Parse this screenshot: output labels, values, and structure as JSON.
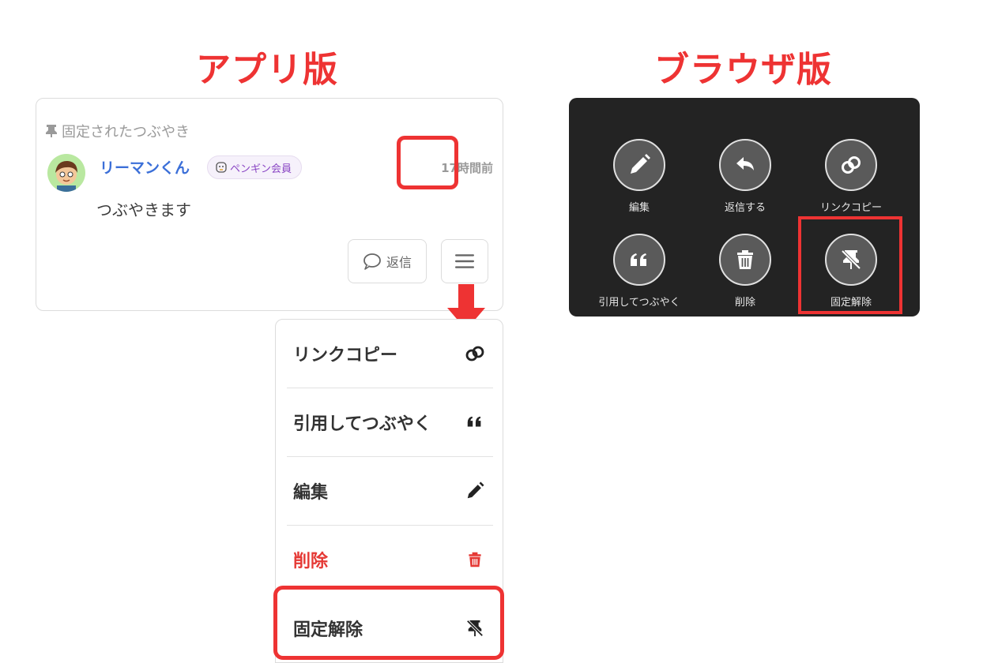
{
  "headings": {
    "app": "アプリ版",
    "browser": "ブラウザ版"
  },
  "colors": {
    "accent_red": "#ee3333",
    "link_blue": "#3b6fd8",
    "badge_purple": "#8a46c4",
    "dark_panel": "#232323"
  },
  "card": {
    "pinned_label": "固定されたつぶやき",
    "username": "リーマンくん",
    "badge": "ペンギン会員",
    "timestamp": "17時間前",
    "text": "つぶやきます",
    "reply_label": "返信"
  },
  "dropdown": {
    "items": [
      {
        "label": "リンクコピー",
        "icon": "link-icon"
      },
      {
        "label": "引用してつぶやく",
        "icon": "quote-icon"
      },
      {
        "label": "編集",
        "icon": "pencil-icon"
      },
      {
        "label": "削除",
        "icon": "trash-icon"
      },
      {
        "label": "固定解除",
        "icon": "unpin-icon"
      }
    ]
  },
  "browser_menu": {
    "items": [
      {
        "label": "編集",
        "icon": "pencil-icon"
      },
      {
        "label": "返信する",
        "icon": "reply-icon"
      },
      {
        "label": "リンクコピー",
        "icon": "link-icon"
      },
      {
        "label": "引用してつぶやく",
        "icon": "quote-icon"
      },
      {
        "label": "削除",
        "icon": "trash-icon"
      },
      {
        "label": "固定解除",
        "icon": "unpin-icon"
      }
    ]
  }
}
